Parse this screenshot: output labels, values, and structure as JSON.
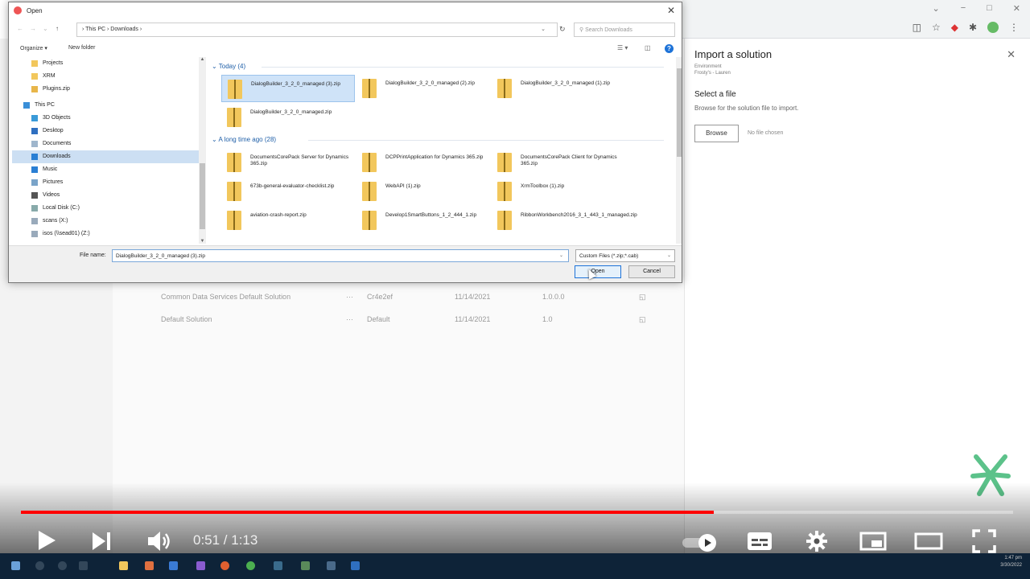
{
  "browser": {
    "controls": [
      "−",
      "□",
      "✕"
    ],
    "chevron": "⌄"
  },
  "background": {
    "rows": [
      {
        "name": "Common Data Services Default Solution",
        "dots": "···",
        "publisher": "Cr4e2ef",
        "date": "11/14/2021",
        "version": "1.0.0.0"
      },
      {
        "name": "Default Solution",
        "dots": "···",
        "publisher": "Default",
        "date": "11/14/2021",
        "version": "1.0"
      }
    ]
  },
  "panel": {
    "title": "Import a solution",
    "env_label": "Environment",
    "env_value": "Frosty's - Lauren",
    "select_label": "Select a file",
    "description": "Browse for the solution file to import.",
    "browse_label": "Browse",
    "no_file": "No file chosen"
  },
  "dialog": {
    "title": "Open",
    "path": "› This PC › Downloads ›",
    "search_placeholder": "Search Downloads",
    "organize": "Organize ▾",
    "new_folder": "New folder",
    "nav_items": [
      {
        "label": "Projects",
        "icon": "folder-icon"
      },
      {
        "label": "XRM",
        "icon": "folder-icon"
      },
      {
        "label": "Plugins.zip",
        "icon": "zip-icon"
      },
      {
        "label": "This PC",
        "icon": "computer-icon"
      },
      {
        "label": "3D Objects",
        "icon": "cube-icon"
      },
      {
        "label": "Desktop",
        "icon": "desktop-icon"
      },
      {
        "label": "Documents",
        "icon": "document-icon"
      },
      {
        "label": "Downloads",
        "icon": "download-icon"
      },
      {
        "label": "Music",
        "icon": "music-icon"
      },
      {
        "label": "Pictures",
        "icon": "picture-icon"
      },
      {
        "label": "Videos",
        "icon": "video-icon"
      },
      {
        "label": "Local Disk (C:)",
        "icon": "disk-icon"
      },
      {
        "label": "scans (X:)",
        "icon": "network-drive-icon"
      },
      {
        "label": "isos (\\\\sead01) (Z:)",
        "icon": "network-drive-icon"
      }
    ],
    "groups": {
      "today": "Today (4)",
      "long_ago": "A long time ago (28)"
    },
    "files_today": [
      "DialogBuilder_3_2_0_managed (3).zip",
      "DialogBuilder_3_2_0_managed (2).zip",
      "DialogBuilder_3_2_0_managed (1).zip",
      "DialogBuilder_3_2_0_managed.zip"
    ],
    "files_old": [
      "DocumentsCorePack Server for Dynamics 365.zip",
      "DCPPrintApplication for Dynamics 365.zip",
      "DocumentsCorePack Client for Dynamics 365.zip",
      "673b-general-evaluator-checklist.zip",
      "WebAPI (1).zip",
      "XrmToolbox (1).zip",
      "aviation-crash-report.zip",
      "Develop1SmartButtons_1_2_444_1.zip",
      "RibbonWorkbench2016_3_1_443_1_managed.zip"
    ],
    "file_name_label": "File name:",
    "file_name_value": "DialogBuilder_3_2_0_managed (3).zip",
    "file_type": "Custom Files (*.zip;*.cab)",
    "open_label": "Open",
    "cancel_label": "Cancel"
  },
  "player": {
    "time": "0:51 / 1:13",
    "progress": 0.698
  },
  "taskbar": {
    "clock_time": "1:47 pm",
    "clock_date": "3/30/2022"
  },
  "colors": {
    "accent": "#1e73d8",
    "progress": "#ff0000",
    "folder": "#f2c75c",
    "logo": "#5cc28a"
  }
}
